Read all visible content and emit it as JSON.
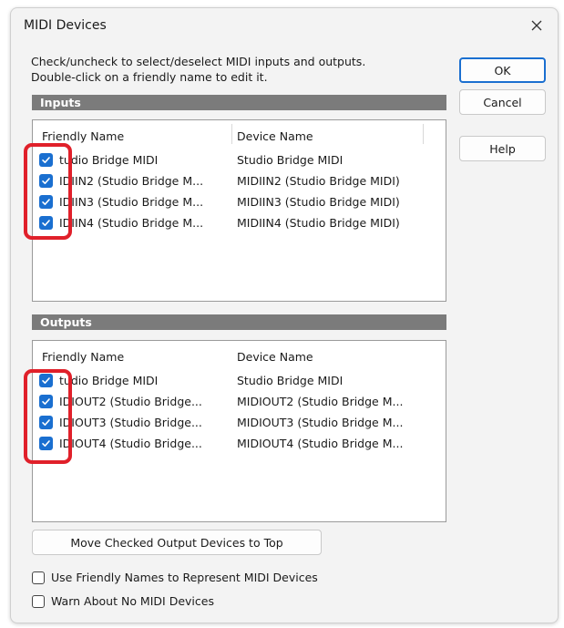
{
  "window": {
    "title": "MIDI Devices"
  },
  "instructions": [
    "Check/uncheck to select/deselect MIDI inputs and outputs.",
    "Double-click on a friendly name to edit it."
  ],
  "buttons": {
    "ok": "OK",
    "cancel": "Cancel",
    "help": "Help",
    "move_top": "Move Checked Output Devices to Top"
  },
  "inputs": {
    "header": "Inputs",
    "columns": {
      "friendly": "Friendly Name",
      "device": "Device Name"
    },
    "rows": [
      {
        "friendly": "tudio Bridge MIDI",
        "device": "Studio Bridge MIDI",
        "checked": true
      },
      {
        "friendly": "IDIIN2 (Studio Bridge M...",
        "device": "MIDIIN2 (Studio Bridge MIDI)",
        "checked": true
      },
      {
        "friendly": "IDIIN3 (Studio Bridge M...",
        "device": "MIDIIN3 (Studio Bridge MIDI)",
        "checked": true
      },
      {
        "friendly": "IDIIN4 (Studio Bridge M...",
        "device": "MIDIIN4 (Studio Bridge MIDI)",
        "checked": true
      }
    ]
  },
  "outputs": {
    "header": "Outputs",
    "columns": {
      "friendly": "Friendly Name",
      "device": "Device Name"
    },
    "rows": [
      {
        "friendly": "tudio Bridge MIDI",
        "device": "Studio Bridge MIDI",
        "checked": true
      },
      {
        "friendly": "IDIOUT2 (Studio Bridge...",
        "device": "MIDIOUT2 (Studio Bridge M...",
        "checked": true
      },
      {
        "friendly": "IDIOUT3 (Studio Bridge...",
        "device": "MIDIOUT3 (Studio Bridge M...",
        "checked": true
      },
      {
        "friendly": "IDIOUT4 (Studio Bridge...",
        "device": "MIDIOUT4 (Studio Bridge M...",
        "checked": true
      }
    ]
  },
  "options": [
    {
      "label": "Use Friendly Names to Represent MIDI Devices",
      "checked": false
    },
    {
      "label": "Warn About No MIDI Devices",
      "checked": false
    }
  ],
  "colors": {
    "accent": "#1a6fd0",
    "section_header": "#7b7b7b",
    "highlight": "#e0202a"
  },
  "icons": {
    "close": "close-icon",
    "checkbox": "checkmark-icon"
  }
}
